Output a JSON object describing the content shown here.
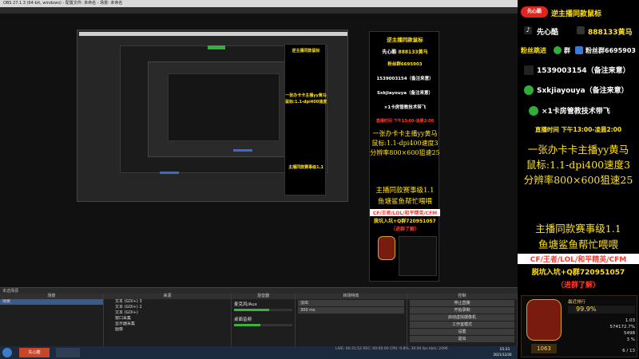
{
  "window": {
    "title": "OBS 27.1.3 (64-bit, windows) - 配置文件: 未命名 - 场景: 未命名"
  },
  "sidebar": {
    "header_badge": "先心酷",
    "header_title": "逆主播同款鼠标",
    "douyin": "先心酷",
    "douyin_id": "888133黄马",
    "fans_label": "粉丝跳进",
    "fans_group": "群",
    "fans_group2": "粉丝群6695903",
    "phone": "1539003154（备注来意）",
    "wechat": "Sxkjiayouya（备注来意）",
    "room_line": "×1卡房管教技术带飞",
    "live_time": "直播时间 下午13:00-凌晨2:00",
    "desc1": "一张办卡卡主播yy黄马",
    "desc2": "鼠标:1.1-dpi400速度3",
    "desc3": "分辨率800×600狙速25",
    "event1": "主播同款赛事级1.1",
    "event2": "鱼塘鲨鱼帮忙喂喂",
    "games": "CF/王者/LOL/和平精英/CFM",
    "qq": "脱坑入坑+Q群720951057",
    "learn": "（进群了解）",
    "stats": {
      "level": "99.9%",
      "rank_label": "最近排行",
      "rows": [
        {
          "k": "",
          "v": "1.03"
        },
        {
          "k": "",
          "v": "574172.7%"
        },
        {
          "k": "",
          "v": "5498"
        },
        {
          "k": "",
          "v": "3 %"
        },
        {
          "k": "",
          "v": "6 / 13"
        }
      ],
      "badge_num": "1063"
    }
  },
  "center": {
    "title": "逆主播同款鼠标",
    "douyin": "先心酷",
    "douyin_id": "888133黄马",
    "fans": "粉丝群6695903",
    "phone": "1539003154（备注来意）",
    "wechat": "Sxkjiayouya（备注来意）",
    "room": "×1卡房管教技术带飞",
    "time": "直播时间 下午13:00-凌晨2:00",
    "desc1": "一张办卡卡主播yy黄马",
    "desc2": "鼠标:1.1-dpi400速度3",
    "desc3": "分辨率800×600狙速25",
    "event1": "主播同款赛事级1.1",
    "event2": "鱼塘鲨鱼帮忙喂喂",
    "games": "CF/王者/LOL/和平精英/CFM",
    "qq": "脱坑入坑+Q群720951057",
    "learn": "（进群了解）"
  },
  "docks": {
    "control_label": "未选择源",
    "scenes_header": "场景",
    "sources_header": "来源",
    "mixer_header": "混音器",
    "transitions_header": "转场特效",
    "controls_header": "控制",
    "scene_item": "场景",
    "sources": [
      "文本 (GDI+) 3",
      "文本 (GDI+) 2",
      "文本 (GDI+)",
      "窗口采集",
      "显示器采集",
      "图像"
    ],
    "mixer": [
      {
        "name": "麦克风/Aux",
        "level": 0.6
      },
      {
        "name": "桌面音频",
        "level": 0.45
      }
    ],
    "transition": "淡出",
    "duration": "300 ms",
    "controls": [
      "停止直播",
      "开始录制",
      "启动虚拟摄像机",
      "工作室模式",
      "设置",
      "退出"
    ]
  },
  "status": {
    "live": "LIVE: 00:31:52",
    "rec": "REC: 00:00:00",
    "cpu": "CPU: 9.8%, 30.00 fps",
    "kbps": "kb/s: 2496"
  },
  "taskbar": {
    "app1": "先心酷",
    "time": "15:21",
    "date": "2021/12/30"
  }
}
